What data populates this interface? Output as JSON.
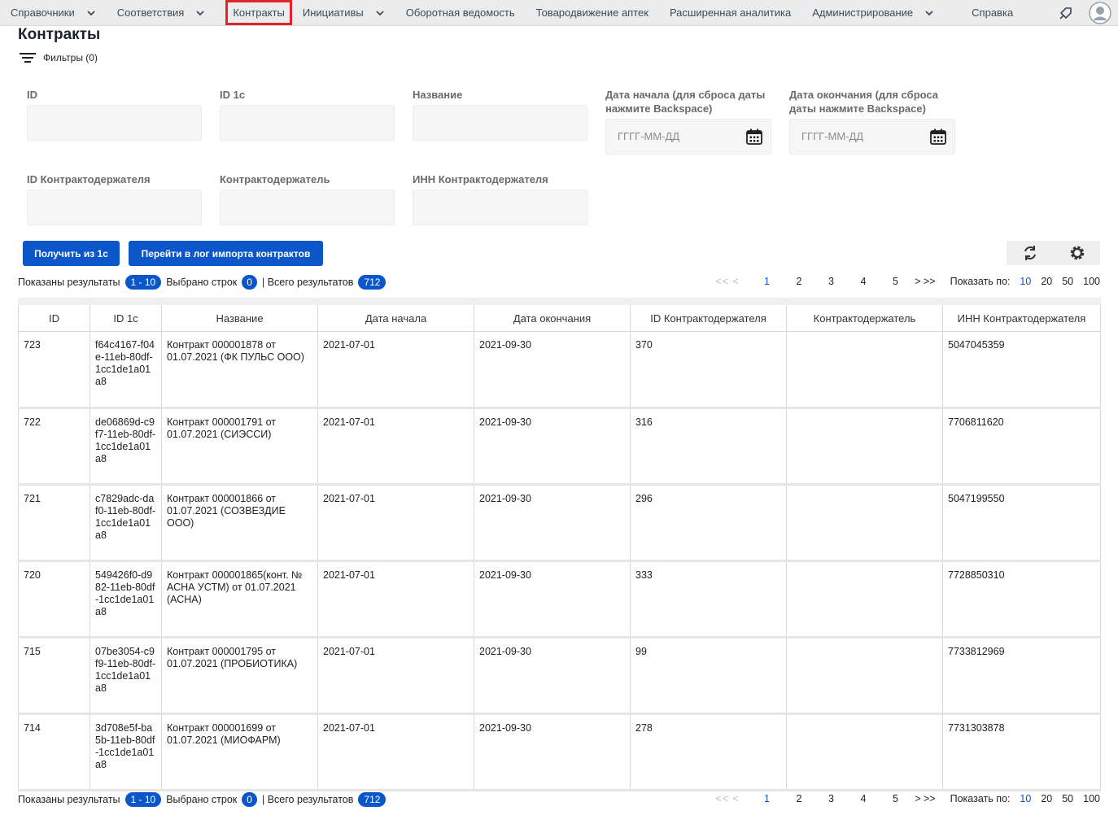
{
  "nav": {
    "items": [
      {
        "label": "Справочники",
        "dropdown": true
      },
      {
        "label": "Соответствия",
        "dropdown": true
      },
      {
        "label": "Контракты",
        "dropdown": false,
        "active": true
      },
      {
        "label": "Инициативы",
        "dropdown": true
      },
      {
        "label": "Оборотная ведомость",
        "dropdown": false
      },
      {
        "label": "Товародвижение аптек",
        "dropdown": false
      },
      {
        "label": "Расширенная аналитика",
        "dropdown": false
      },
      {
        "label": "Администрирование",
        "dropdown": true
      },
      {
        "label": "Справка",
        "dropdown": false
      }
    ]
  },
  "page": {
    "title": "Контракты",
    "filters_label": "Фильтры (0)"
  },
  "filters": {
    "id": {
      "label": "ID",
      "value": ""
    },
    "id1c": {
      "label": "ID 1с",
      "value": ""
    },
    "name": {
      "label": "Название",
      "value": ""
    },
    "start_date": {
      "label": "Дата начала (для сброса даты нажмите Backspace)",
      "placeholder": "ГГГГ-ММ-ДД"
    },
    "end_date": {
      "label": "Дата окончания (для сброса даты нажмите Backspace)",
      "placeholder": "ГГГГ-ММ-ДД"
    },
    "holder_id": {
      "label": "ID Контрактодержателя",
      "value": ""
    },
    "holder": {
      "label": "Контрактодержатель",
      "value": ""
    },
    "holder_inn": {
      "label": "ИНН Контрактодержателя",
      "value": ""
    }
  },
  "actions": {
    "get_1c": "Получить из 1с",
    "import_log": "Перейти в лог импорта контрактов"
  },
  "summary": {
    "shown_label": "Показаны результаты",
    "shown_range": "1 - 10",
    "selected_label": "Выбрано строк",
    "selected_count": "0",
    "total_label": "| Всего результатов",
    "total_count": "712"
  },
  "pagination": {
    "first_prev": "<< <",
    "pages": [
      "1",
      "2",
      "3",
      "4",
      "5"
    ],
    "next_last": "> >>",
    "show_label": "Показать по:",
    "sizes": [
      "10",
      "20",
      "50",
      "100"
    ],
    "current_size": "10"
  },
  "table": {
    "columns": [
      "ID",
      "ID 1с",
      "Название",
      "Дата начала",
      "Дата окончания",
      "ID Контрактодержателя",
      "Контрактодержатель",
      "ИНН Контрактодержателя"
    ],
    "rows": [
      [
        "723",
        "f64c4167-f04e-11eb-80df-1cc1de1a01a8",
        "Контракт 000001878 от 01.07.2021 (ФК ПУЛЬС ООО)",
        "2021-07-01",
        "2021-09-30",
        "370",
        "",
        "5047045359"
      ],
      [
        "722",
        "de06869d-c9f7-11eb-80df-1cc1de1a01a8",
        "Контракт 000001791 от 01.07.2021 (СИЭССИ)",
        "2021-07-01",
        "2021-09-30",
        "316",
        "",
        "7706811620"
      ],
      [
        "721",
        "c7829adc-daf0-11eb-80df-1cc1de1a01a8",
        "Контракт 000001866 от 01.07.2021 (СОЗВЕЗДИЕ ООО)",
        "2021-07-01",
        "2021-09-30",
        "296",
        "",
        "5047199550"
      ],
      [
        "720",
        "549426f0-d982-11eb-80df-1cc1de1a01a8",
        "Контракт 000001865(конт. № АСНА УСТМ) от 01.07.2021 (АСНА)",
        "2021-07-01",
        "2021-09-30",
        "333",
        "",
        "7728850310"
      ],
      [
        "715",
        "07be3054-c9f9-11eb-80df-1cc1de1a01a8",
        "Контракт 000001795 от 01.07.2021 (ПРОБИОТИКА)",
        "2021-07-01",
        "2021-09-30",
        "99",
        "",
        "7733812969"
      ],
      [
        "714",
        "3d708e5f-ba5b-11eb-80df-1cc1de1a01a8",
        "Контракт 000001699 от 01.07.2021 (МИОФАРМ)",
        "2021-07-01",
        "2021-09-30",
        "278",
        "",
        "7731303878"
      ]
    ]
  },
  "icons": {
    "filter": "filter-lines-icon",
    "calendar": "calendar-icon",
    "refresh": "refresh-icon",
    "settings": "gear-icon",
    "bell": "tag-bell-icon",
    "avatar": "user-avatar-icon"
  },
  "colors": {
    "accent": "#0b56c9",
    "active_outline": "#e0262a"
  }
}
